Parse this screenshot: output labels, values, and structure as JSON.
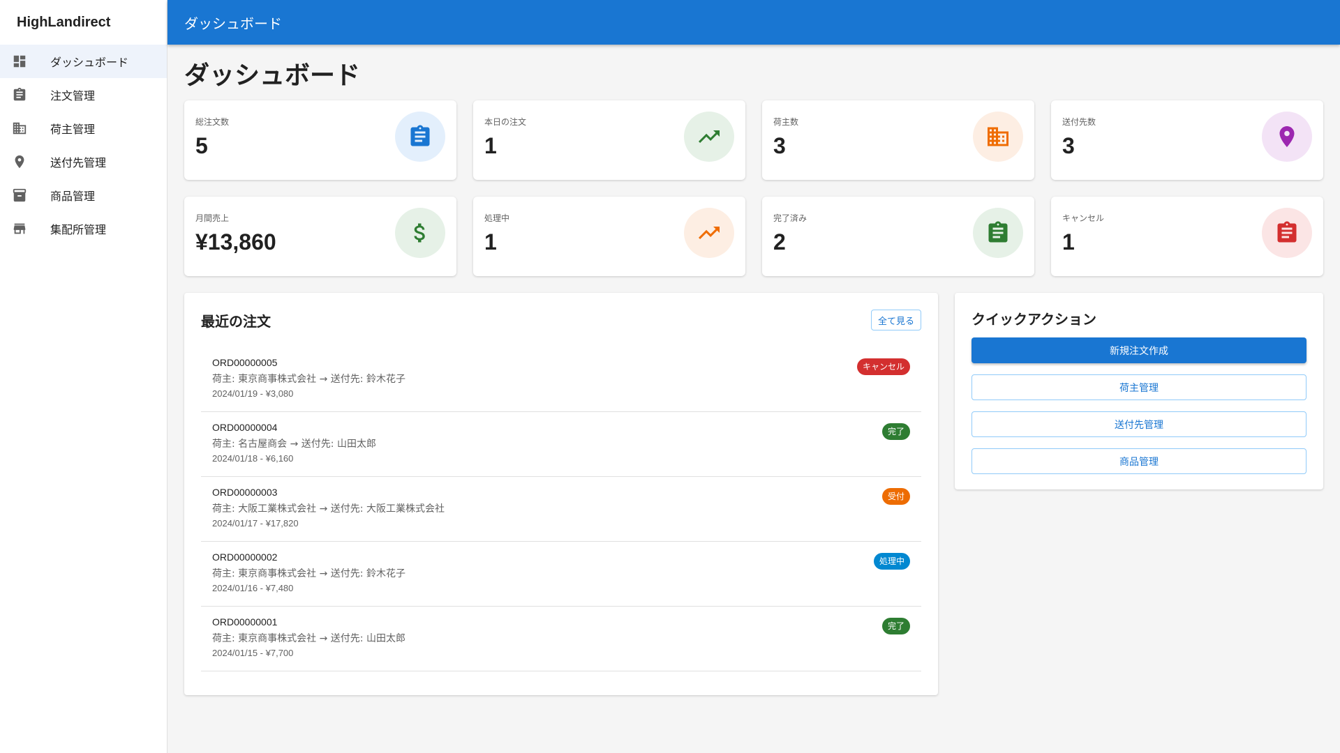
{
  "app": {
    "brand": "HighLandirect",
    "appbar_title": "ダッシュボード"
  },
  "sidebar": {
    "items": [
      {
        "label": "ダッシュボード",
        "icon": "dashboard-icon",
        "active": true
      },
      {
        "label": "注文管理",
        "icon": "clipboard-icon"
      },
      {
        "label": "荷主管理",
        "icon": "building-icon"
      },
      {
        "label": "送付先管理",
        "icon": "location-pin-icon"
      },
      {
        "label": "商品管理",
        "icon": "archive-box-icon"
      },
      {
        "label": "集配所管理",
        "icon": "store-icon"
      }
    ]
  },
  "page": {
    "title": "ダッシュボード"
  },
  "stats": [
    {
      "label": "総注文数",
      "value": "5",
      "icon": "clipboard-icon",
      "bg": "#e3effc",
      "fg": "#1976d2"
    },
    {
      "label": "本日の注文",
      "value": "1",
      "icon": "trending-up-icon",
      "bg": "#e6f1e7",
      "fg": "#2e7d32"
    },
    {
      "label": "荷主数",
      "value": "3",
      "icon": "building-icon",
      "bg": "#fdeee3",
      "fg": "#ef6c00"
    },
    {
      "label": "送付先数",
      "value": "3",
      "icon": "location-pin-icon",
      "bg": "#f3e3f6",
      "fg": "#9c27b0"
    },
    {
      "label": "月間売上",
      "value": "¥13,860",
      "icon": "dollar-icon",
      "bg": "#e6f1e7",
      "fg": "#2e7d32"
    },
    {
      "label": "処理中",
      "value": "1",
      "icon": "trending-up-icon",
      "bg": "#fdeee3",
      "fg": "#ef6c00"
    },
    {
      "label": "完了済み",
      "value": "2",
      "icon": "clipboard-icon",
      "bg": "#e6f1e7",
      "fg": "#2e7d32"
    },
    {
      "label": "キャンセル",
      "value": "1",
      "icon": "clipboard-icon",
      "bg": "#fbe5e5",
      "fg": "#d32f2f"
    }
  ],
  "recent_orders": {
    "title": "最近の注文",
    "view_all_label": "全て見る",
    "items": [
      {
        "id": "ORD00000005",
        "detail": "荷主: 東京商事株式会社 → 送付先: 鈴木花子",
        "date_amount": "2024/01/19 - ¥3,080",
        "status": "キャンセル",
        "status_color": "#d32f2f"
      },
      {
        "id": "ORD00000004",
        "detail": "荷主: 名古屋商会 → 送付先: 山田太郎",
        "date_amount": "2024/01/18 - ¥6,160",
        "status": "完了",
        "status_color": "#2e7d32"
      },
      {
        "id": "ORD00000003",
        "detail": "荷主: 大阪工業株式会社 → 送付先: 大阪工業株式会社",
        "date_amount": "2024/01/17 - ¥17,820",
        "status": "受付",
        "status_color": "#ed6c02"
      },
      {
        "id": "ORD00000002",
        "detail": "荷主: 東京商事株式会社 → 送付先: 鈴木花子",
        "date_amount": "2024/01/16 - ¥7,480",
        "status": "処理中",
        "status_color": "#0288d1"
      },
      {
        "id": "ORD00000001",
        "detail": "荷主: 東京商事株式会社 → 送付先: 山田太郎",
        "date_amount": "2024/01/15 - ¥7,700",
        "status": "完了",
        "status_color": "#2e7d32"
      }
    ]
  },
  "quick_actions": {
    "title": "クイックアクション",
    "buttons": [
      {
        "label": "新規注文作成",
        "style": "primary"
      },
      {
        "label": "荷主管理",
        "style": "outline"
      },
      {
        "label": "送付先管理",
        "style": "outline"
      },
      {
        "label": "商品管理",
        "style": "outline"
      }
    ]
  }
}
